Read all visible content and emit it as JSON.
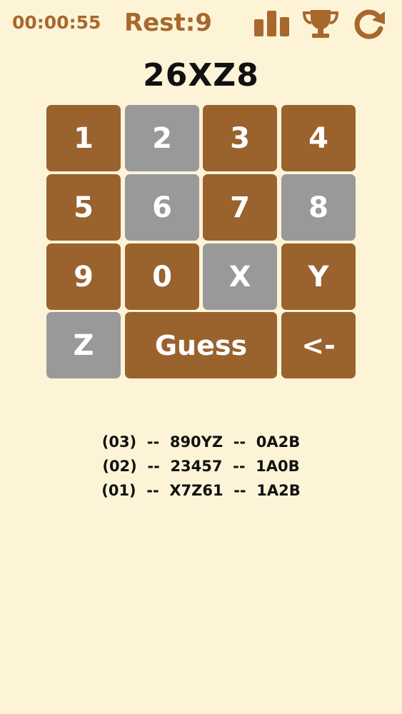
{
  "header": {
    "timer": "00:00:55",
    "rest": "Rest:9",
    "accent_color": "#a8682c",
    "icons": [
      "bar-chart-icon",
      "trophy-icon",
      "reload-icon"
    ]
  },
  "current_guess": "26XZ8",
  "keypad": {
    "active_color": "#9a622d",
    "used_color": "#999999",
    "keys": [
      {
        "label": "1",
        "state": "active"
      },
      {
        "label": "2",
        "state": "used"
      },
      {
        "label": "3",
        "state": "active"
      },
      {
        "label": "4",
        "state": "active"
      },
      {
        "label": "5",
        "state": "active"
      },
      {
        "label": "6",
        "state": "used"
      },
      {
        "label": "7",
        "state": "active"
      },
      {
        "label": "8",
        "state": "used"
      },
      {
        "label": "9",
        "state": "active"
      },
      {
        "label": "0",
        "state": "active"
      },
      {
        "label": "X",
        "state": "used"
      },
      {
        "label": "Y",
        "state": "active"
      },
      {
        "label": "Z",
        "state": "used"
      },
      {
        "label": "Guess",
        "state": "active"
      },
      {
        "label": "<-",
        "state": "active"
      }
    ]
  },
  "history": [
    "(03)  --  890YZ  --  0A2B",
    "(02)  --  23457  --  1A0B",
    "(01)  --  X7Z61  --  1A2B"
  ]
}
